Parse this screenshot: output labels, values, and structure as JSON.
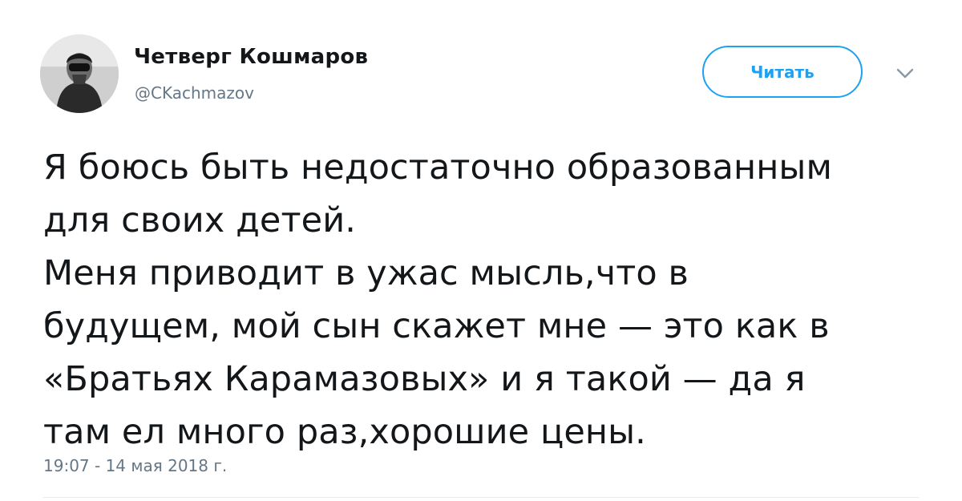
{
  "author": {
    "display_name": "Четверг Кошмаров",
    "handle": "@CKachmazov",
    "avatar_icon": "profile-photo"
  },
  "follow_button": {
    "label": "Читать",
    "accent_color": "#1da1f2"
  },
  "menu": {
    "icon": "chevron-down-icon"
  },
  "tweet": {
    "text": "Я боюсь быть недостаточно образованным\nдля своих детей.\nМеня приводит в ужас мысль,что в\nбудущем, мой сын скажет мне — это как в\n«Братьях Карамазовых» и я такой — да я\nтам ел много раз,хорошие цены.",
    "timestamp": "19:07 - 14 мая 2018 г."
  },
  "colors": {
    "text": "#14171a",
    "secondary_text": "#657786",
    "divider": "#e6ecf0"
  }
}
